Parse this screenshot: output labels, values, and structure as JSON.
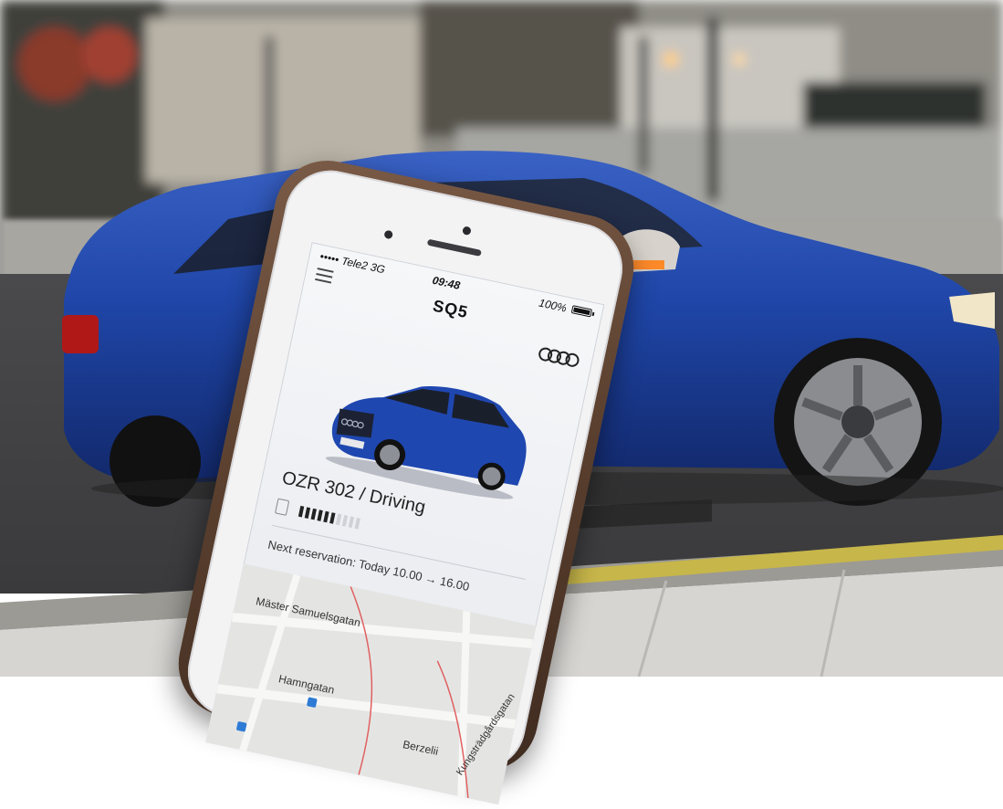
{
  "colors": {
    "car_body": "#1e45a6",
    "sky": "#c9c8c2",
    "phone_case": "#5a3f2e",
    "screen_bg": "#eef0f3",
    "fuel_fill": "#222222",
    "fuel_empty": "#cfd1d6"
  },
  "phone": {
    "status_bar": {
      "carrier": "••••• Tele2  3G",
      "time": "09:48",
      "battery": "100%",
      "battery_icon": "battery-full-icon"
    },
    "header": {
      "menu_icon": "hamburger-menu-icon",
      "model": "SQ5",
      "brand_logo": "audi-four-rings-logo"
    },
    "car": {
      "image": "blue-audi-sq5-thumbnail",
      "plate_status": "OZR 302 / Driving",
      "fuel_icon": "fuel-pump-icon",
      "fuel_level": 0.6
    },
    "next_reservation": "Next reservation: Today 10.00 → 16.00",
    "map": {
      "streets": [
        "Mäster Samuelsgatan",
        "Hamngatan",
        "Kungsträdgårdsgatan",
        "Berzelii"
      ]
    }
  }
}
